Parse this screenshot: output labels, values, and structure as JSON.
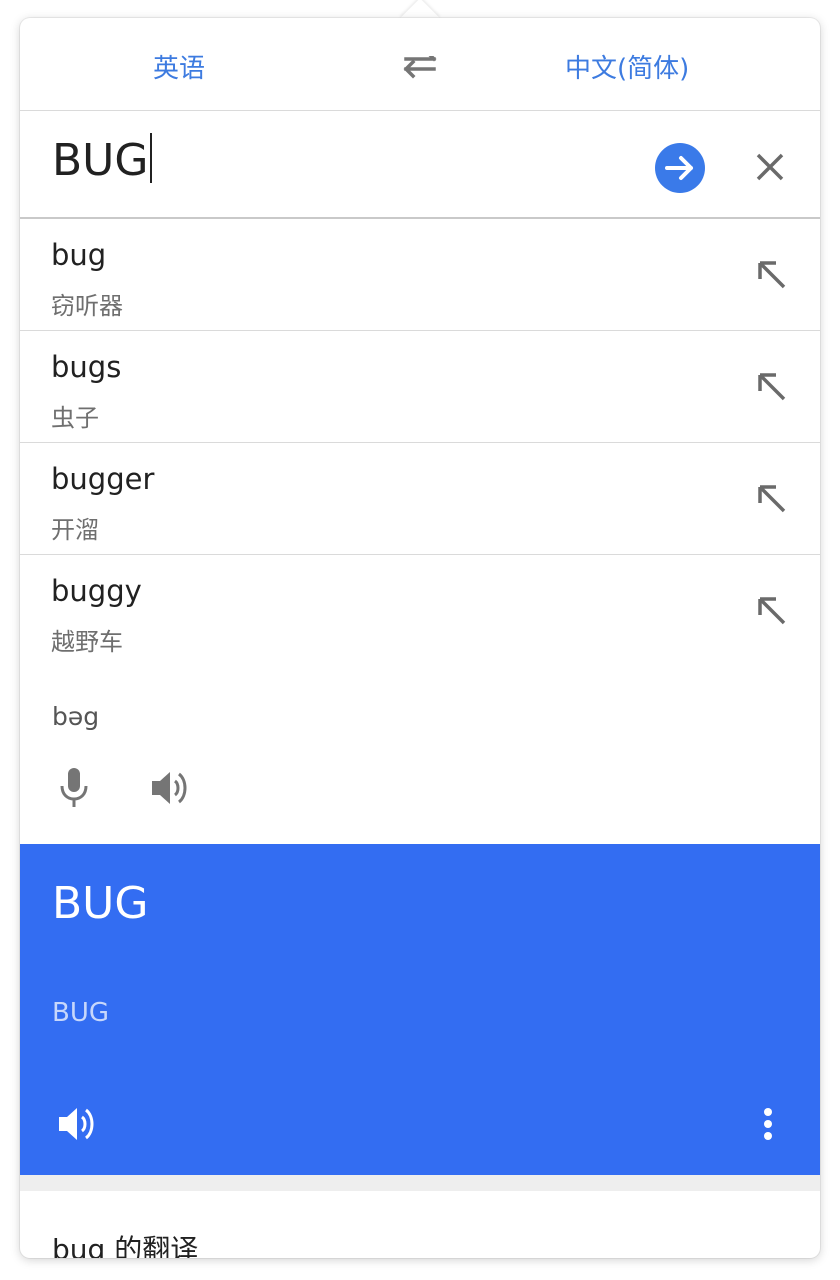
{
  "languages": {
    "source": "英语",
    "target": "中文(简体)"
  },
  "input": {
    "value": "BUG"
  },
  "suggestions": [
    {
      "word": "bug",
      "translation": "窃听器"
    },
    {
      "word": "bugs",
      "translation": "虫子"
    },
    {
      "word": "bugger",
      "translation": "开溜"
    },
    {
      "word": "buggy",
      "translation": "越野车"
    }
  ],
  "phonetic": "bəg",
  "result": {
    "translation": "BUG",
    "romanization": "BUG"
  },
  "section": {
    "title": "bug 的翻译"
  },
  "icons": {
    "swap": "swap-arrows-icon",
    "go": "arrow-right-icon",
    "clear": "close-icon",
    "insert": "arrow-up-left-icon",
    "mic": "microphone-icon",
    "speaker": "speaker-icon",
    "more": "more-vertical-icon"
  },
  "colors": {
    "accent": "#3d7be0",
    "result_background": "#336df2",
    "go_button": "#3a7ae9"
  }
}
